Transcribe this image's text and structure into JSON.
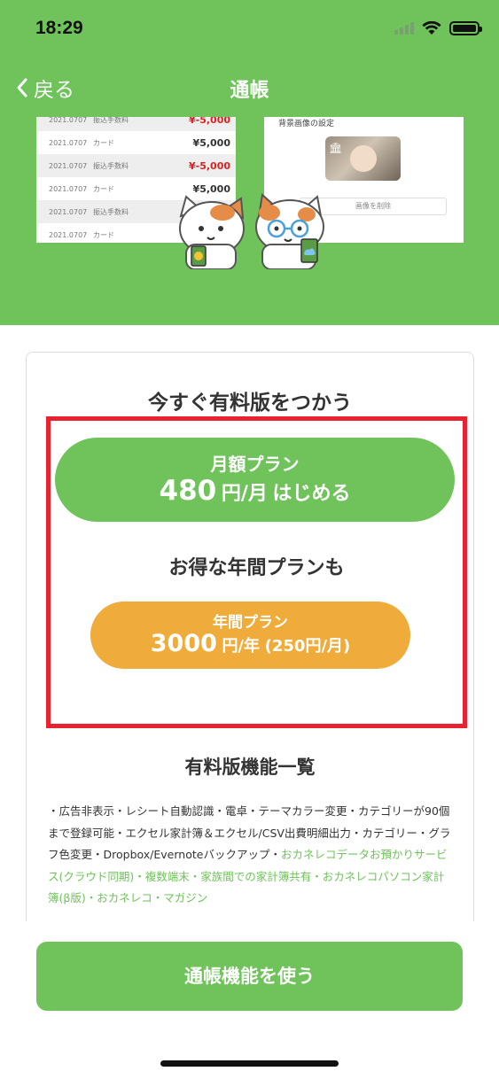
{
  "status_bar": {
    "time": "18:29"
  },
  "nav": {
    "back_label": "戻る",
    "title": "通帳"
  },
  "preview_list": [
    {
      "date": "2021.0707",
      "label": "振込手数料",
      "amount": "¥-5,000",
      "negative": true
    },
    {
      "date": "2021.0707",
      "label": "カード",
      "amount": "¥5,000",
      "negative": false
    },
    {
      "date": "2021.0707",
      "label": "振込手数料",
      "amount": "¥-5,000",
      "negative": true
    },
    {
      "date": "2021.0707",
      "label": "カード",
      "amount": "¥5,000",
      "negative": false
    },
    {
      "date": "2021.0707",
      "label": "振込手数料",
      "amount": "¥-5,000",
      "negative": true
    },
    {
      "date": "2021.0707",
      "label": "カード",
      "amount": "",
      "negative": false
    }
  ],
  "preview_settings": {
    "title": "背景画像の設定",
    "delete_label": "画像を削除"
  },
  "plans": {
    "heading": "今すぐ有料版をつかう",
    "monthly": {
      "name": "月額プラン",
      "price": "480",
      "unit": "円/月",
      "action": "はじめる"
    },
    "annual_heading": "お得な年間プランも",
    "annual": {
      "name": "年間プラン",
      "price": "3000",
      "unit": "円/年",
      "note": "(250円/月)"
    }
  },
  "features": {
    "heading": "有料版機能一覧",
    "text_plain": "・広告非表示・レシート自動認識・電卓・テーマカラー変更・カテゴリーが90個まで登録可能・エクセル家計簿＆エクセル/CSV出費明細出力・カテゴリー・グラフ色変更・Dropbox/Evernoteバックアップ・",
    "text_green": "おカネレコデータお預かりサービス(クラウド同期)・複数端末・家族間での家計簿共有・おカネレコパソコン家計簿(β版)・おカネレコ・マガジン"
  },
  "bottom": {
    "button_label": "通帳機能を使う"
  },
  "colors": {
    "brand_green": "#6fc35a",
    "annual_orange": "#f0ac3a",
    "highlight_red": "#e8232f",
    "negative_red": "#e02020"
  }
}
